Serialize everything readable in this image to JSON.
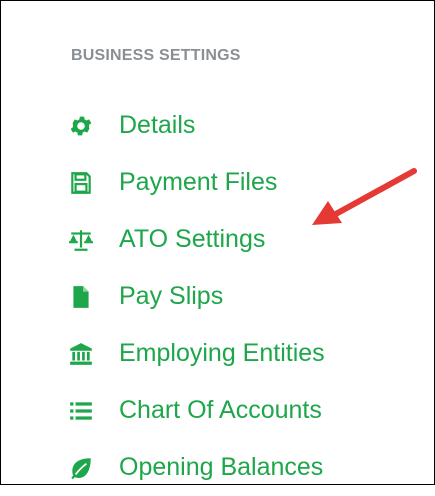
{
  "section_title": "BUSINESS SETTINGS",
  "accent_color": "#1da64a",
  "annotation_color": "#e53935",
  "items": [
    {
      "label": "Details",
      "icon": "gear-icon"
    },
    {
      "label": "Payment Files",
      "icon": "floppy-disk-icon"
    },
    {
      "label": "ATO Settings",
      "icon": "balance-scale-icon"
    },
    {
      "label": "Pay Slips",
      "icon": "file-icon"
    },
    {
      "label": "Employing Entities",
      "icon": "bank-building-icon"
    },
    {
      "label": "Chart Of Accounts",
      "icon": "list-icon"
    },
    {
      "label": "Opening Balances",
      "icon": "leaf-icon"
    }
  ]
}
